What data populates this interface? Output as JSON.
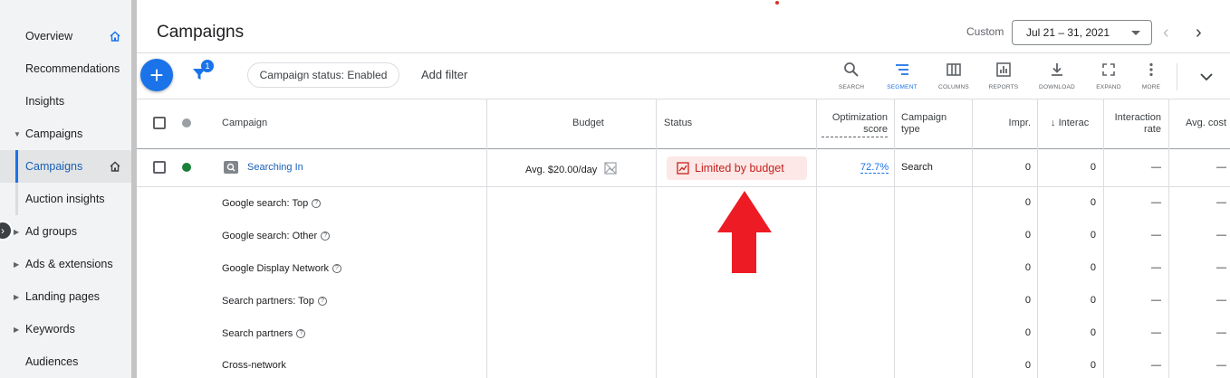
{
  "sidebar": {
    "items": [
      {
        "label": "Overview"
      },
      {
        "label": "Recommendations"
      },
      {
        "label": "Insights"
      },
      {
        "label": "Campaigns"
      },
      {
        "label": "Campaigns"
      },
      {
        "label": "Auction insights"
      },
      {
        "label": "Ad groups"
      },
      {
        "label": "Ads & extensions"
      },
      {
        "label": "Landing pages"
      },
      {
        "label": "Keywords"
      },
      {
        "label": "Audiences"
      }
    ]
  },
  "header": {
    "title": "Campaigns",
    "custom_label": "Custom",
    "date_range": "Jul 21 – 31, 2021"
  },
  "toolbar": {
    "add_button": "+",
    "filter_badge": "1",
    "status_chip": "Campaign status: Enabled",
    "add_filter": "Add filter",
    "tools": [
      {
        "label": "SEARCH",
        "icon": "search-icon"
      },
      {
        "label": "SEGMENT",
        "icon": "segment-icon"
      },
      {
        "label": "COLUMNS",
        "icon": "columns-icon"
      },
      {
        "label": "REPORTS",
        "icon": "reports-icon"
      },
      {
        "label": "DOWNLOAD",
        "icon": "download-icon"
      },
      {
        "label": "EXPAND",
        "icon": "expand-icon"
      },
      {
        "label": "MORE",
        "icon": "more-icon"
      }
    ]
  },
  "table": {
    "headers": {
      "campaign": "Campaign",
      "budget": "Budget",
      "status": "Status",
      "opt_1": "Optimization",
      "opt_2": "score",
      "type_1": "Campaign",
      "type_2": "type",
      "impr": "Impr.",
      "interac": "Interac",
      "rate_1": "Interaction",
      "rate_2": "rate",
      "avg": "Avg. cost"
    },
    "campaign_row": {
      "name": "Searching In",
      "budget": "Avg. $20.00/day",
      "status": "Limited by budget",
      "opt_score": "72.7%",
      "type": "Search",
      "impr": "0",
      "interac": "0",
      "rate": "—",
      "avg": "—"
    },
    "segment_rows": [
      {
        "label": "Google search: Top",
        "help": true,
        "impr": "0",
        "interac": "0",
        "rate": "—",
        "avg": "—"
      },
      {
        "label": "Google search: Other",
        "help": true,
        "impr": "0",
        "interac": "0",
        "rate": "—",
        "avg": "—"
      },
      {
        "label": "Google Display Network",
        "help": true,
        "impr": "0",
        "interac": "0",
        "rate": "—",
        "avg": "—"
      },
      {
        "label": "Search partners: Top",
        "help": true,
        "impr": "0",
        "interac": "0",
        "rate": "—",
        "avg": "—"
      },
      {
        "label": "Search partners",
        "help": true,
        "impr": "0",
        "interac": "0",
        "rate": "—",
        "avg": "—"
      },
      {
        "label": "Cross-network",
        "help": false,
        "impr": "0",
        "interac": "0",
        "rate": "—",
        "avg": "—"
      }
    ]
  },
  "colors": {
    "accent": "#1a73e8",
    "status_bg": "#fce8e6",
    "status_text": "#c5221f",
    "annotation_arrow": "#ed1c24",
    "enabled_dot": "#188038"
  }
}
